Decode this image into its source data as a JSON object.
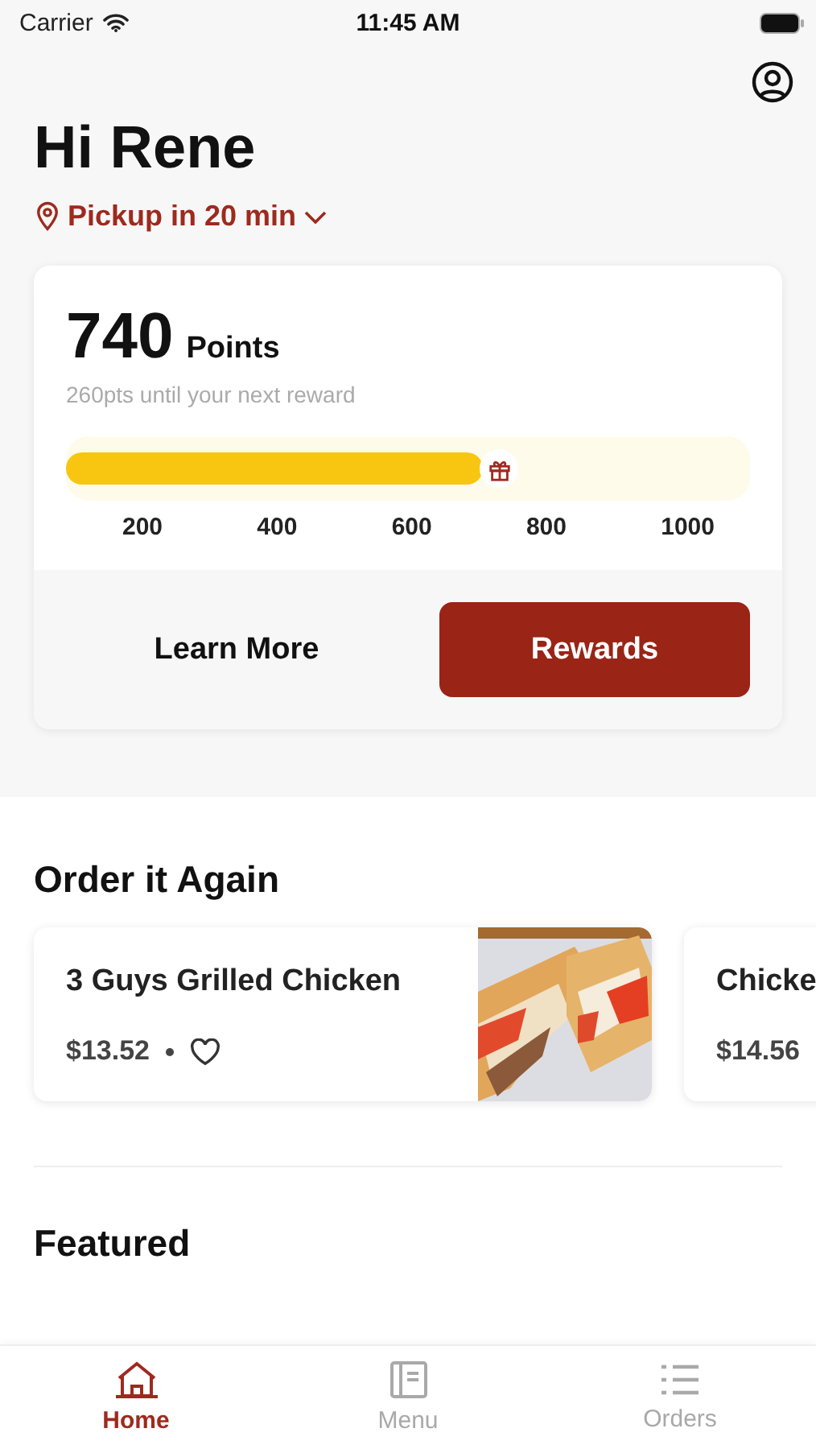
{
  "status_bar": {
    "carrier": "Carrier",
    "time": "11:45 AM"
  },
  "greeting": "Hi Rene",
  "pickup": "Pickup in 20 min",
  "points_card": {
    "points": "740",
    "points_label": "Points",
    "subtitle": "260pts until your next reward",
    "level": 0.61,
    "ticks": [
      "200",
      "400",
      "600",
      "800",
      "1000"
    ],
    "learn_more": "Learn More",
    "rewards": "Rewards"
  },
  "order_again": {
    "title": "Order it Again",
    "items": [
      {
        "name": "3 Guys Grilled Chicken",
        "price": "$13.52",
        "favorite": false,
        "kind": "picture"
      },
      {
        "name": "Chicke",
        "price": "$14.56"
      }
    ]
  },
  "featured": {
    "title": "Featured"
  },
  "tabs": [
    {
      "label": "Home",
      "selected": true
    },
    {
      "label": "Menu",
      "selected": false
    },
    {
      "label": "Orders",
      "selected": false
    }
  ]
}
